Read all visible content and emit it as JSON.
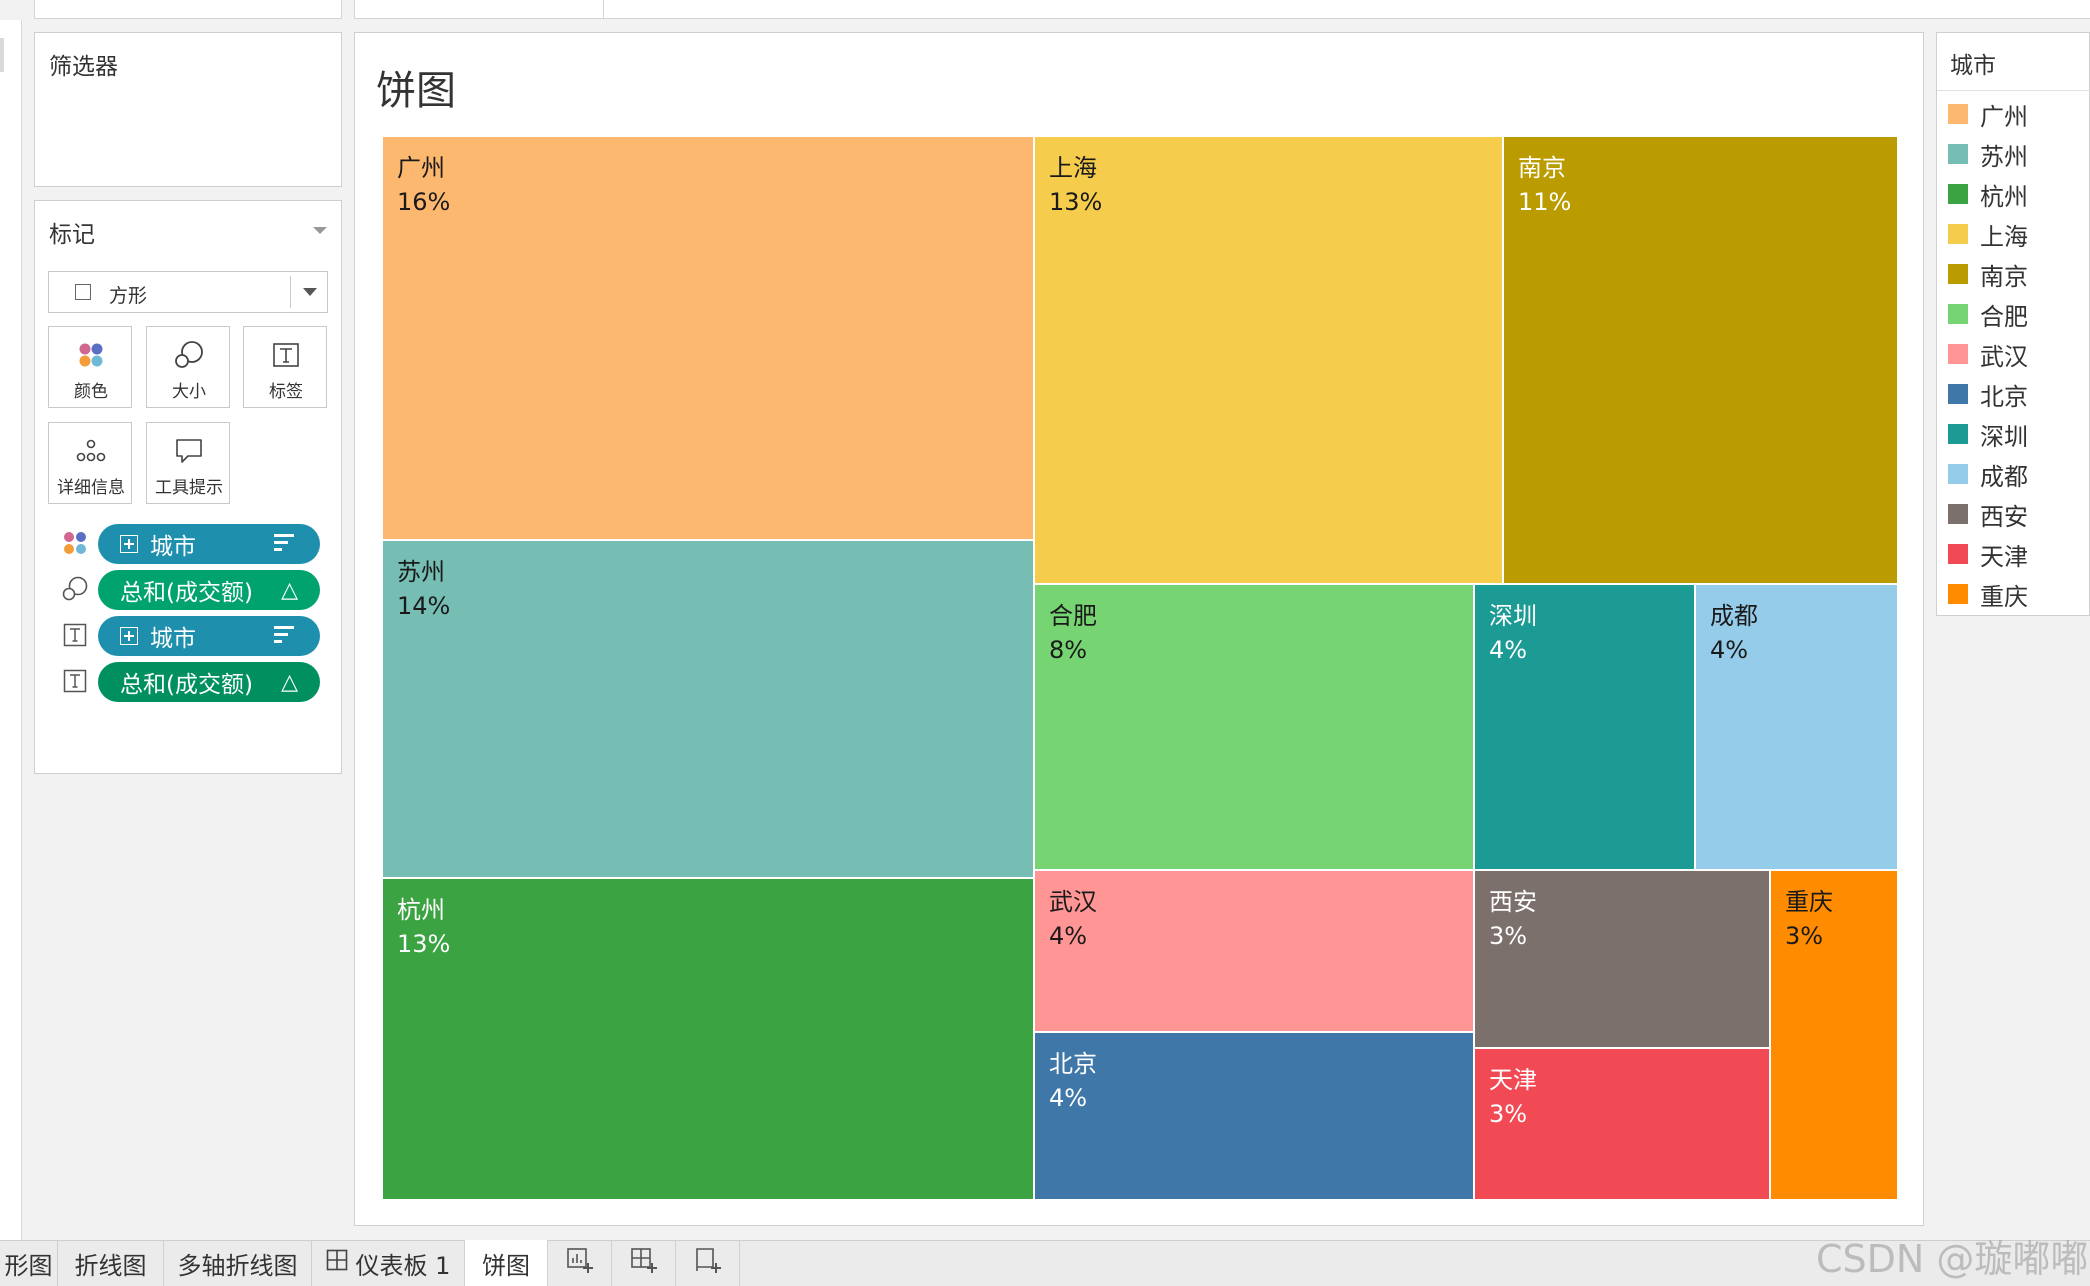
{
  "filters": {
    "title": "筛选器"
  },
  "marks": {
    "title": "标记",
    "mark_type": "方形",
    "buttons": [
      {
        "label": "颜色",
        "icon": "color-dots-icon"
      },
      {
        "label": "大小",
        "icon": "size-circles-icon"
      },
      {
        "label": "标签",
        "icon": "text-label-icon"
      },
      {
        "label": "详细信息",
        "icon": "detail-dots-icon"
      },
      {
        "label": "工具提示",
        "icon": "tooltip-bubble-icon"
      }
    ],
    "shelf": [
      {
        "role": "color",
        "text": "城市"
      },
      {
        "role": "size",
        "text": "总和(成交额)"
      },
      {
        "role": "label",
        "text": "城市"
      },
      {
        "role": "label",
        "text": "总和(成交额)"
      }
    ]
  },
  "view": {
    "title": "饼图"
  },
  "legend": {
    "title": "城市",
    "items": [
      {
        "label": "广州",
        "color": "#FDB86F"
      },
      {
        "label": "苏州",
        "color": "#76BEB4"
      },
      {
        "label": "杭州",
        "color": "#3BA342"
      },
      {
        "label": "上海",
        "color": "#F5CC4C"
      },
      {
        "label": "南京",
        "color": "#BA9B00"
      },
      {
        "label": "合肥",
        "color": "#77D473"
      },
      {
        "label": "武汉",
        "color": "#FF9594"
      },
      {
        "label": "北京",
        "color": "#3F78A8"
      },
      {
        "label": "深圳",
        "color": "#1C9A94"
      },
      {
        "label": "成都",
        "color": "#95CCEA"
      },
      {
        "label": "西安",
        "color": "#7C706C"
      },
      {
        "label": "天津",
        "color": "#F24A55"
      },
      {
        "label": "重庆",
        "color": "#FF8C00"
      }
    ]
  },
  "chart_data": {
    "type": "treemap",
    "title": "饼图",
    "measure": "总和(成交额)",
    "dimension": "城市",
    "cells": [
      {
        "name": "广州",
        "label": "16%",
        "percent": 16,
        "color": "#FDB86F",
        "text_color": "#1a1a1a"
      },
      {
        "name": "苏州",
        "label": "14%",
        "percent": 14,
        "color": "#76BEB4",
        "text_color": "#1a1a1a"
      },
      {
        "name": "杭州",
        "label": "13%",
        "percent": 13,
        "color": "#3BA342",
        "text_color": "#ffffff"
      },
      {
        "name": "上海",
        "label": "13%",
        "percent": 13,
        "color": "#F5CC4C",
        "text_color": "#1a1a1a"
      },
      {
        "name": "南京",
        "label": "11%",
        "percent": 11,
        "color": "#BA9B00",
        "text_color": "#ffffff"
      },
      {
        "name": "合肥",
        "label": "8%",
        "percent": 8,
        "color": "#77D473",
        "text_color": "#1a1a1a"
      },
      {
        "name": "深圳",
        "label": "4%",
        "percent": 4,
        "color": "#1C9A94",
        "text_color": "#ffffff"
      },
      {
        "name": "成都",
        "label": "4%",
        "percent": 4,
        "color": "#95CCEA",
        "text_color": "#1a1a1a"
      },
      {
        "name": "武汉",
        "label": "4%",
        "percent": 4,
        "color": "#FF9594",
        "text_color": "#1a1a1a"
      },
      {
        "name": "北京",
        "label": "4%",
        "percent": 4,
        "color": "#3F78A8",
        "text_color": "#ffffff"
      },
      {
        "name": "西安",
        "label": "3%",
        "percent": 3,
        "color": "#7C706C",
        "text_color": "#ffffff"
      },
      {
        "name": "天津",
        "label": "3%",
        "percent": 3,
        "color": "#F24A55",
        "text_color": "#ffffff"
      },
      {
        "name": "重庆",
        "label": "3%",
        "percent": 3,
        "color": "#FF8C00",
        "text_color": "#1a1a1a"
      }
    ]
  },
  "tabs": [
    {
      "label": "形图"
    },
    {
      "label": "折线图"
    },
    {
      "label": "多轴折线图"
    },
    {
      "label": "仪表板 1"
    },
    {
      "label": "饼图",
      "active": true
    }
  ],
  "watermark": "CSDN @璇嘟嘟"
}
